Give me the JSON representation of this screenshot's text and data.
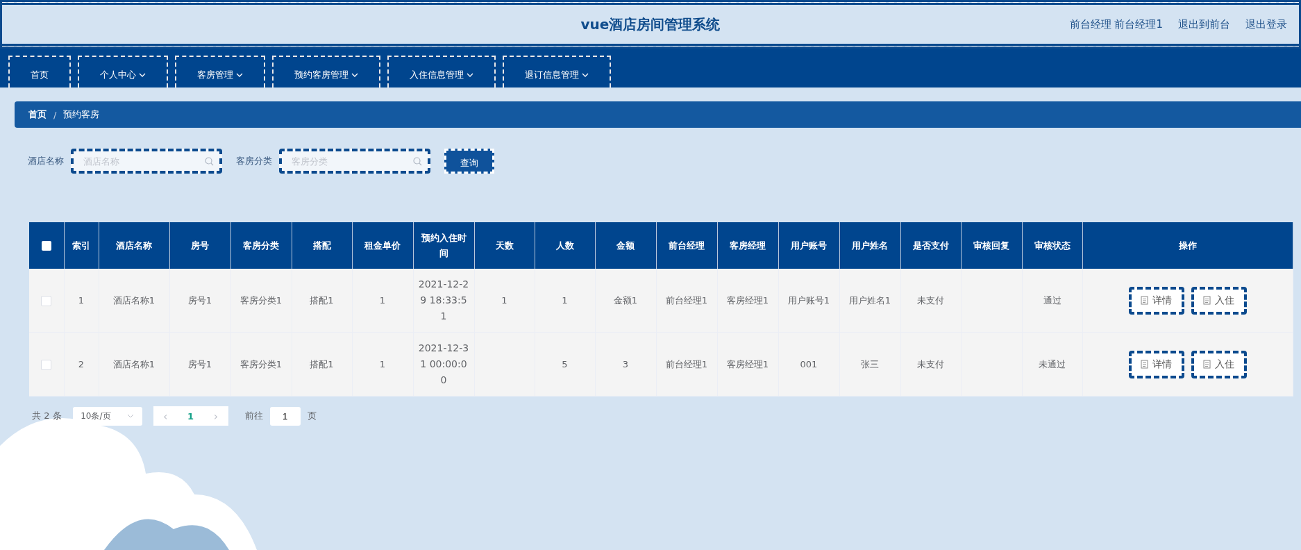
{
  "header": {
    "title": "vue酒店房间管理系统",
    "user": "前台经理 前台经理1",
    "links": [
      "退出到前台",
      "退出登录"
    ]
  },
  "nav": [
    {
      "label": "首页",
      "dropdown": false
    },
    {
      "label": "个人中心",
      "dropdown": true
    },
    {
      "label": "客房管理",
      "dropdown": true
    },
    {
      "label": "预约客房管理",
      "dropdown": true
    },
    {
      "label": "入住信息管理",
      "dropdown": true
    },
    {
      "label": "退订信息管理",
      "dropdown": true
    }
  ],
  "breadcrumb": [
    "首页",
    "预约客房"
  ],
  "breadcrumb_separator": "/",
  "search": {
    "fields": [
      {
        "label": "酒店名称",
        "placeholder": "酒店名称"
      },
      {
        "label": "客房分类",
        "placeholder": "客房分类"
      }
    ],
    "button": "查询"
  },
  "table": {
    "select_all": {
      "checked": false
    },
    "columns": [
      "索引",
      "酒店名称",
      "房号",
      "客房分类",
      "搭配",
      "租金单价",
      "预约入住时间",
      "天数",
      "人数",
      "金额",
      "前台经理",
      "客房经理",
      "用户账号",
      "用户姓名",
      "是否支付",
      "审核回复",
      "审核状态",
      "操作"
    ],
    "rows": [
      {
        "checked": false,
        "cells": [
          "1",
          "酒店名称1",
          "房号1",
          "客房分类1",
          "搭配1",
          "1",
          "2021-12-29 18:33:51",
          "1",
          "1",
          "金额1",
          "前台经理1",
          "客房经理1",
          "用户账号1",
          "用户姓名1",
          "未支付",
          null,
          "通过"
        ],
        "actions": [
          "详情",
          "入住"
        ]
      },
      {
        "checked": false,
        "cells": [
          "2",
          "酒店名称1",
          "房号1",
          "客房分类1",
          "搭配1",
          "1",
          "2021-12-31 00:00:00",
          null,
          "5",
          "3",
          "前台经理1",
          "客房经理1",
          "001",
          "张三",
          "未支付",
          null,
          "未通过"
        ],
        "actions": [
          "详情",
          "入住"
        ]
      }
    ]
  },
  "pagination": {
    "total": "共 2 条",
    "page_size": "10条/页",
    "prev": "‹",
    "current": "1",
    "next": "›",
    "goto_label": "前往",
    "goto_value": "1",
    "goto_suffix": "页"
  }
}
